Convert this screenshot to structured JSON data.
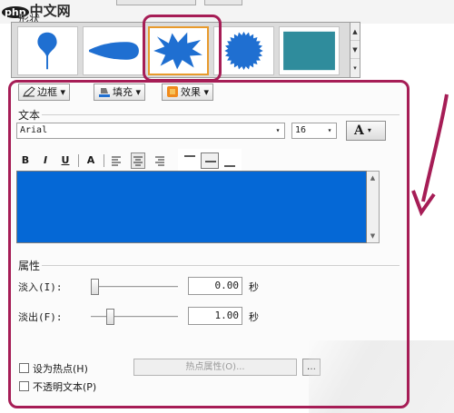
{
  "watermark": {
    "logo": "php",
    "text": "中文网"
  },
  "shapes": {
    "group_label": "形状",
    "gallery": [
      {
        "name": "pin"
      },
      {
        "name": "teardrop"
      },
      {
        "name": "explosion",
        "selected": true
      },
      {
        "name": "seal-starburst"
      },
      {
        "name": "rectangle"
      }
    ],
    "scroll_up": "▲",
    "scroll_down": "▼",
    "scroll_more": "▾"
  },
  "toolbar": {
    "border_label": "边框",
    "fill_label": "填充",
    "effect_label": "效果",
    "dropdown": "▾"
  },
  "text_group": {
    "label": "文本",
    "font_name": "Arial",
    "font_size": "16",
    "font_color_button": "A",
    "dropdown": "▾",
    "format": {
      "bold": "B",
      "italic": "I",
      "underline": "U",
      "text_color": "A"
    },
    "scroll_up": "▲",
    "scroll_down": "▼"
  },
  "properties": {
    "label": "属性",
    "fade_in_label": "淡入(I):",
    "fade_in_value": "0.00",
    "fade_in_slider": 0.0,
    "fade_out_label": "淡出(F):",
    "fade_out_value": "1.00",
    "fade_out_slider": 0.2,
    "unit": "秒",
    "hotspot_label": "设为热点(H)",
    "hotspot_props_label": "热点属性(O)...",
    "side_button_label": "…",
    "opaque_text_label": "不透明文本(P)"
  },
  "colors": {
    "highlight": "#a61d56",
    "text_area": "#0568d6",
    "shape_fill": "#1f6fd1",
    "rect_fill": "#2f8c9c",
    "selected_border": "#e89a2c"
  }
}
